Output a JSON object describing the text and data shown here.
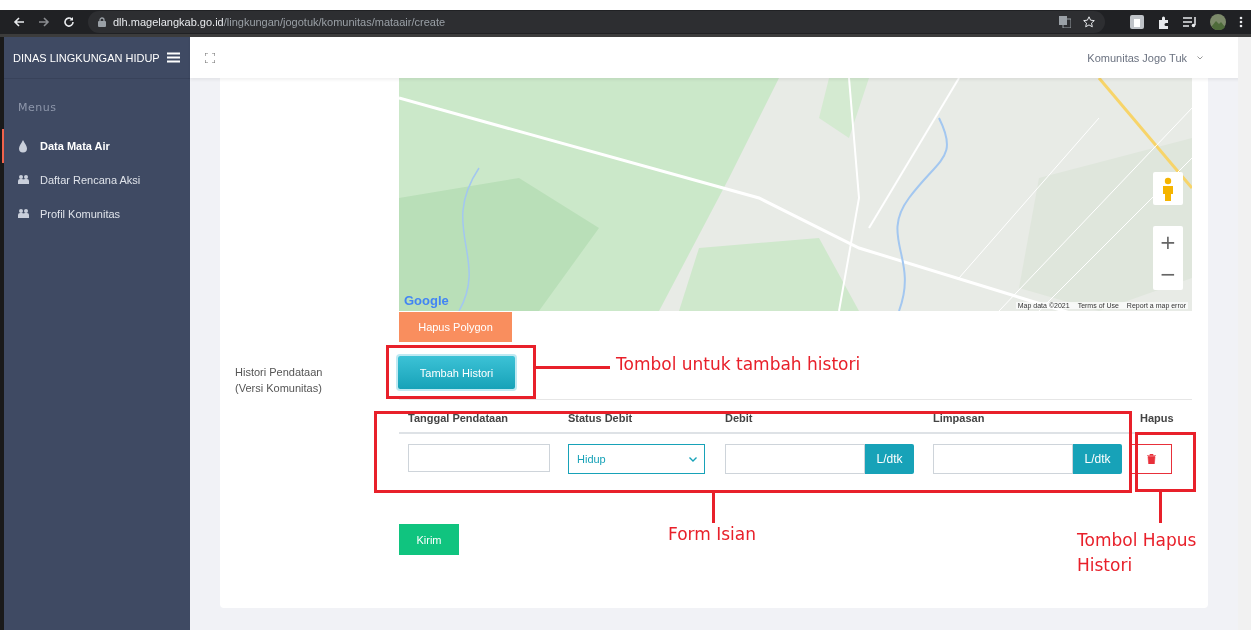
{
  "browser": {
    "url_host": "dlh.magelangkab.go.id",
    "url_path": "/lingkungan/jogotuk/komunitas/mataair/create"
  },
  "sidebar": {
    "brand": "DINAS LINGKUNGAN HIDUP",
    "section_label": "Menus",
    "items": [
      {
        "label": "Data Mata Air",
        "kind": "drop",
        "selected": true
      },
      {
        "label": "Daftar Rencana Aksi",
        "kind": "group",
        "selected": false
      },
      {
        "label": "Profil Komunitas",
        "kind": "group",
        "selected": false
      }
    ]
  },
  "header": {
    "user": "Komunitas Jogo Tuk"
  },
  "map": {
    "logo": "Google",
    "zoom_in": "+",
    "zoom_out": "−",
    "attribution": [
      "Map data ©2021",
      "Terms of Use",
      "Report a map error"
    ]
  },
  "form": {
    "polygon_button": "Hapus Polygon",
    "history_label": "Histori Pendataan",
    "history_sublabel": "(Versi Komunitas)",
    "add_button": "Tambah Histori",
    "columns": [
      "Tanggal Pendataan",
      "Status Debit",
      "Debit",
      "Limpasan",
      "Hapus"
    ],
    "row": {
      "status": "Hidup",
      "debit_unit": "L/dtk",
      "limpasan_unit": "L/dtk"
    },
    "submit": "Kirim"
  },
  "annotations": [
    {
      "text": "Tombol untuk tambah histori"
    },
    {
      "text": "Form Isian"
    },
    {
      "text": "Tombol Hapus Histori"
    }
  ]
}
